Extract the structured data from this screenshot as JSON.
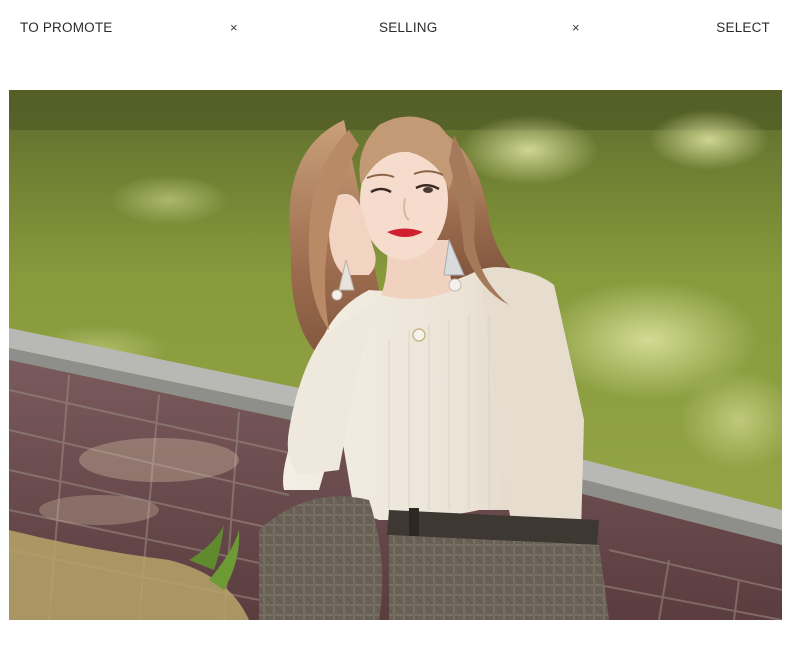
{
  "banner": {
    "left_label": "TO PROMOTE",
    "center_label": "SELLING",
    "right_label": "SELECT",
    "separator": "×"
  },
  "photo": {
    "subject": "model-photo"
  },
  "colors": {
    "text": "#2b2b2b",
    "background": "#ffffff",
    "grass": "#8a9a3b",
    "bricks": "#6e4a4d",
    "sweater": "#efe9df",
    "trousers": "#6d6559"
  }
}
